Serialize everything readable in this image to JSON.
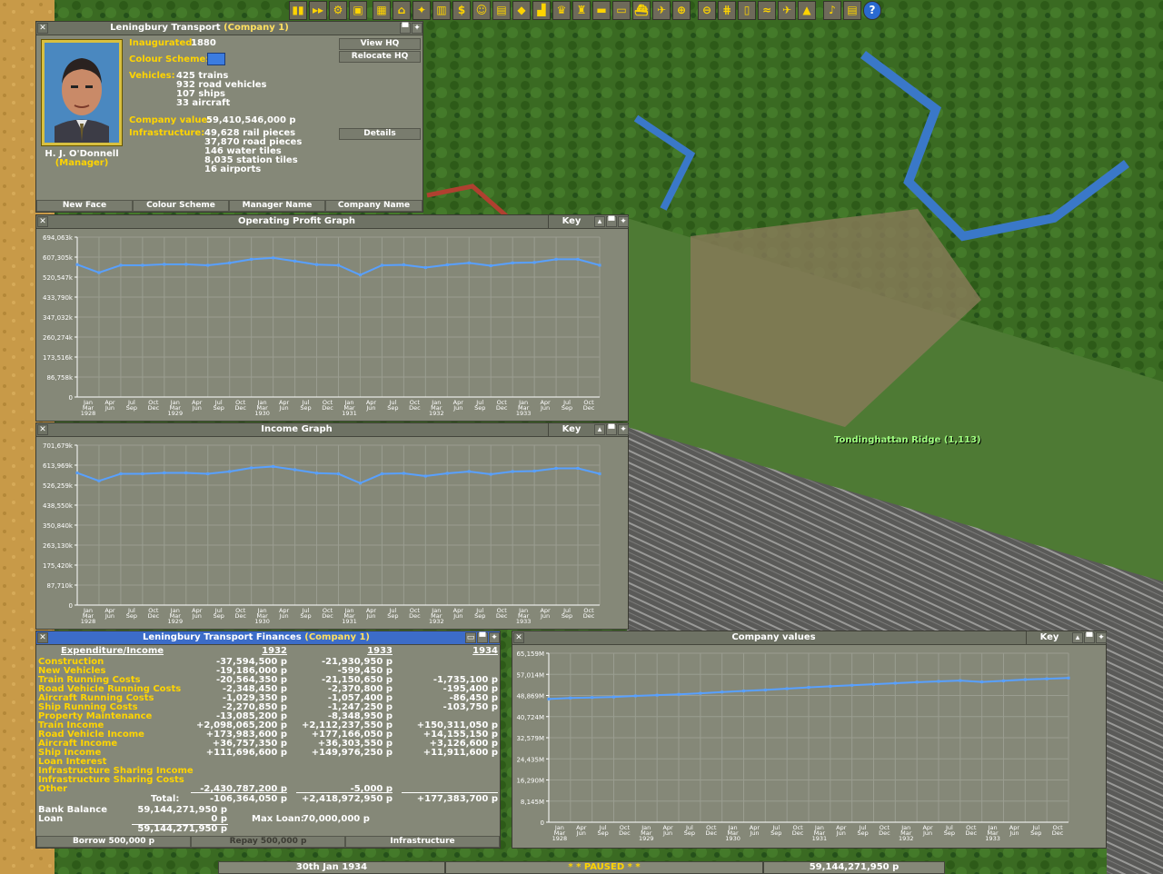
{
  "toolbar": {
    "tools": [
      {
        "name": "pause-icon",
        "glyph": "▮▮"
      },
      {
        "name": "fast-forward-icon",
        "glyph": "▸▸"
      },
      {
        "name": "settings-icon",
        "glyph": "⚙"
      },
      {
        "name": "save-icon",
        "glyph": "▣"
      },
      {
        "name": "map-icon",
        "glyph": "▦"
      },
      {
        "name": "town-directory-icon",
        "glyph": "⌂"
      },
      {
        "name": "subsidies-icon",
        "glyph": "✦"
      },
      {
        "name": "station-list-icon",
        "glyph": "▥"
      },
      {
        "name": "finances-icon",
        "glyph": "$"
      },
      {
        "name": "company-icon",
        "glyph": "☺"
      },
      {
        "name": "story-icon",
        "glyph": "▤"
      },
      {
        "name": "goals-icon",
        "glyph": "◆"
      },
      {
        "name": "graphs-icon",
        "glyph": "▟"
      },
      {
        "name": "league-icon",
        "glyph": "♛"
      },
      {
        "name": "industry-icon",
        "glyph": "♜"
      },
      {
        "name": "trains-icon",
        "glyph": "▬"
      },
      {
        "name": "road-vehicles-icon",
        "glyph": "▭"
      },
      {
        "name": "ships-icon",
        "glyph": "⛴"
      },
      {
        "name": "aircraft-icon",
        "glyph": "✈"
      },
      {
        "name": "zoom-in-icon",
        "glyph": "⊕"
      },
      {
        "name": "zoom-out-icon",
        "glyph": "⊖"
      },
      {
        "name": "rail-construction-icon",
        "glyph": "⋕"
      },
      {
        "name": "road-construction-icon",
        "glyph": "▯"
      },
      {
        "name": "water-construction-icon",
        "glyph": "≈"
      },
      {
        "name": "airport-construction-icon",
        "glyph": "✈"
      },
      {
        "name": "landscaping-icon",
        "glyph": "▲"
      },
      {
        "name": "music-icon",
        "glyph": "♪"
      },
      {
        "name": "news-icon",
        "glyph": "▤"
      },
      {
        "name": "help-icon",
        "glyph": "?"
      }
    ]
  },
  "company": {
    "title": "Leningbury Transport",
    "title_sub": "(Company 1)",
    "inaugurated_label": "Inaugurated:",
    "inaugurated_value": "1880",
    "colour_label": "Colour Scheme:",
    "vehicles_label": "Vehicles:",
    "vehicles": [
      "425 trains",
      "932 road vehicles",
      "107 ships",
      "33 aircraft"
    ],
    "value_label": "Company value:",
    "value_value": "59,410,546,000 p",
    "infra_label": "Infrastructure:",
    "infrastructure": [
      "49,628 rail pieces",
      "37,870 road pieces",
      "146 water tiles",
      "8,035 station tiles",
      "16 airports"
    ],
    "manager_name": "H. J. O'Donnell",
    "manager_role": "(Manager)",
    "view_hq": "View HQ",
    "relocate_hq": "Relocate HQ",
    "details": "Details",
    "bottom_buttons": [
      "New Face",
      "Colour Scheme",
      "Manager Name",
      "Company Name"
    ]
  },
  "graph_common": {
    "key": "Key",
    "months": [
      "Jan",
      "Apr",
      "Jul",
      "Oct",
      "Jan",
      "Apr",
      "Jul",
      "Oct",
      "Jan",
      "Apr",
      "Jul",
      "Oct",
      "Jan",
      "Apr",
      "Jul",
      "Oct",
      "Jan",
      "Apr",
      "Jul",
      "Oct",
      "Jan",
      "Apr",
      "Jul",
      "Oct"
    ],
    "months2": [
      "Mar",
      "Jun",
      "Sep",
      "Dec",
      "Mar",
      "Jun",
      "Sep",
      "Dec",
      "Mar",
      "Jun",
      "Sep",
      "Dec",
      "Mar",
      "Jun",
      "Sep",
      "Dec",
      "Mar",
      "Jun",
      "Sep",
      "Dec",
      "Mar",
      "Jun",
      "Sep",
      "Dec"
    ],
    "years": [
      "1928",
      "",
      "",
      "",
      "1929",
      "",
      "",
      "",
      "1930",
      "",
      "",
      "",
      "1931",
      "",
      "",
      "",
      "1932",
      "",
      "",
      "",
      "1933",
      "",
      "",
      ""
    ]
  },
  "chart_data": [
    {
      "type": "line",
      "title": "Operating Profit Graph",
      "yticks": [
        "694,063k",
        "607,305k",
        "520,547k",
        "433,790k",
        "347,032k",
        "260,274k",
        "173,516k",
        "86,758k",
        "0"
      ],
      "ylim": [
        0,
        694063
      ],
      "series": [
        {
          "values": [
            575000,
            540000,
            572000,
            572000,
            576000,
            576000,
            572000,
            582000,
            598000,
            604000,
            590000,
            575000,
            572000,
            530000,
            572000,
            574000,
            562000,
            574000,
            582000,
            570000,
            582000,
            584000,
            598000,
            598000,
            572000
          ]
        }
      ]
    },
    {
      "type": "line",
      "title": "Income Graph",
      "yticks": [
        "701,679k",
        "613,969k",
        "526,259k",
        "438,550k",
        "350,840k",
        "263,130k",
        "175,420k",
        "87,710k",
        "0"
      ],
      "ylim": [
        0,
        701679
      ],
      "series": [
        {
          "values": [
            580000,
            545000,
            576000,
            576000,
            580000,
            580000,
            576000,
            586000,
            602000,
            608000,
            594000,
            579000,
            576000,
            535000,
            576000,
            578000,
            566000,
            578000,
            586000,
            574000,
            586000,
            588000,
            600000,
            600000,
            576000
          ]
        }
      ]
    },
    {
      "type": "line",
      "title": "Company values",
      "yticks": [
        "65,159M",
        "57,014M",
        "48,869M",
        "40,724M",
        "32,579M",
        "24,435M",
        "16,290M",
        "8,145M",
        "0"
      ],
      "ylim": [
        0,
        65159
      ],
      "series": [
        {
          "values": [
            47500,
            47900,
            48100,
            48300,
            48700,
            49000,
            49300,
            49700,
            50200,
            50600,
            51000,
            51500,
            52000,
            52400,
            52800,
            53200,
            53600,
            54000,
            54300,
            54600,
            54100,
            54500,
            55000,
            55300,
            55600
          ]
        }
      ]
    }
  ],
  "finances": {
    "title": "Leningbury Transport Finances",
    "title_sub": "(Company 1)",
    "header": "Expenditure/Income",
    "years": [
      "1932",
      "1933",
      "1934"
    ],
    "rows": [
      {
        "label": "Construction",
        "v": [
          "-37,594,500 p",
          "-21,930,950 p",
          ""
        ]
      },
      {
        "label": "New Vehicles",
        "v": [
          "-19,186,000 p",
          "-599,450 p",
          ""
        ]
      },
      {
        "label": "Train Running Costs",
        "v": [
          "-20,564,350 p",
          "-21,150,650 p",
          "-1,735,100 p"
        ]
      },
      {
        "label": "Road Vehicle Running Costs",
        "v": [
          "-2,348,450 p",
          "-2,370,800 p",
          "-195,400 p"
        ]
      },
      {
        "label": "Aircraft Running Costs",
        "v": [
          "-1,029,350 p",
          "-1,057,400 p",
          "-86,450 p"
        ]
      },
      {
        "label": "Ship Running Costs",
        "v": [
          "-2,270,850 p",
          "-1,247,250 p",
          "-103,750 p"
        ]
      },
      {
        "label": "Property Maintenance",
        "v": [
          "-13,085,200 p",
          "-8,348,950 p",
          ""
        ]
      },
      {
        "label": "Train Income",
        "v": [
          "+2,098,065,200 p",
          "+2,112,237,550 p",
          "+150,311,050 p"
        ]
      },
      {
        "label": "Road Vehicle Income",
        "v": [
          "+173,983,600 p",
          "+177,166,050 p",
          "+14,155,150 p"
        ]
      },
      {
        "label": "Aircraft Income",
        "v": [
          "+36,757,350 p",
          "+36,303,550 p",
          "+3,126,600 p"
        ]
      },
      {
        "label": "Ship Income",
        "v": [
          "+111,696,600 p",
          "+149,976,250 p",
          "+11,911,600 p"
        ]
      },
      {
        "label": "Loan Interest",
        "v": [
          "",
          "",
          ""
        ]
      },
      {
        "label": "Infrastructure Sharing Income",
        "v": [
          "",
          "",
          ""
        ]
      },
      {
        "label": "Infrastructure Sharing Costs",
        "v": [
          "",
          "",
          ""
        ]
      },
      {
        "label": "Other",
        "v": [
          "-2,430,787,200 p",
          "-5,000 p",
          ""
        ]
      }
    ],
    "total_label": "Total:",
    "totals": [
      "-106,364,050 p",
      "+2,418,972,950 p",
      "+177,383,700 p"
    ],
    "bank_balance_label": "Bank Balance",
    "bank_balance": "59,144,271,950 p",
    "loan_label": "Loan",
    "loan": "0 p",
    "max_loan_label": "Max Loan:",
    "max_loan": "70,000,000 p",
    "net": "59,144,271,950 p",
    "borrow": "Borrow 500,000 p",
    "repay": "Repay 500,000 p",
    "infrastructure": "Infrastructure"
  },
  "map": {
    "town_label": "Tondinghattan Ridge (1,113)"
  },
  "status": {
    "date": "30th Jan 1934",
    "paused": "* * PAUSED * *",
    "money": "59,144,271,950 p"
  }
}
